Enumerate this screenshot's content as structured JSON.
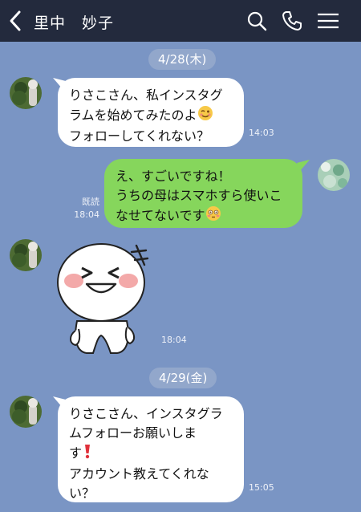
{
  "header": {
    "title": "里中　妙子"
  },
  "messages": [
    {
      "type": "date",
      "label": "4/28(木)"
    },
    {
      "type": "incoming",
      "lines": [
        "りさこさん、私インスタグ",
        "ラムを始めてみたのよ",
        "フォローしてくれない？"
      ],
      "emoji": "winking-face",
      "time": "14:03"
    },
    {
      "type": "outgoing",
      "lines": [
        "え、すごいですね！",
        "うちの母はスマホすら使いこ",
        "なせてないです"
      ],
      "emoji": "flushed-face",
      "read": "既読",
      "time": "18:04"
    },
    {
      "type": "sticker",
      "sticker": "laughing-round-face-sticker",
      "time": "18:04"
    },
    {
      "type": "date",
      "label": "4/29(金)"
    },
    {
      "type": "incoming",
      "lines": [
        "りさこさん、インスタグラ",
        "ムフォローお願いしま",
        "す",
        "アカウント教えてくれな",
        "い？"
      ],
      "emoji": "red-exclamation",
      "time": "15:05"
    }
  ],
  "colors": {
    "background": "#7a95c4",
    "header": "#232a3d",
    "incoming_bubble": "#ffffff",
    "outgoing_bubble": "#86d65c"
  }
}
